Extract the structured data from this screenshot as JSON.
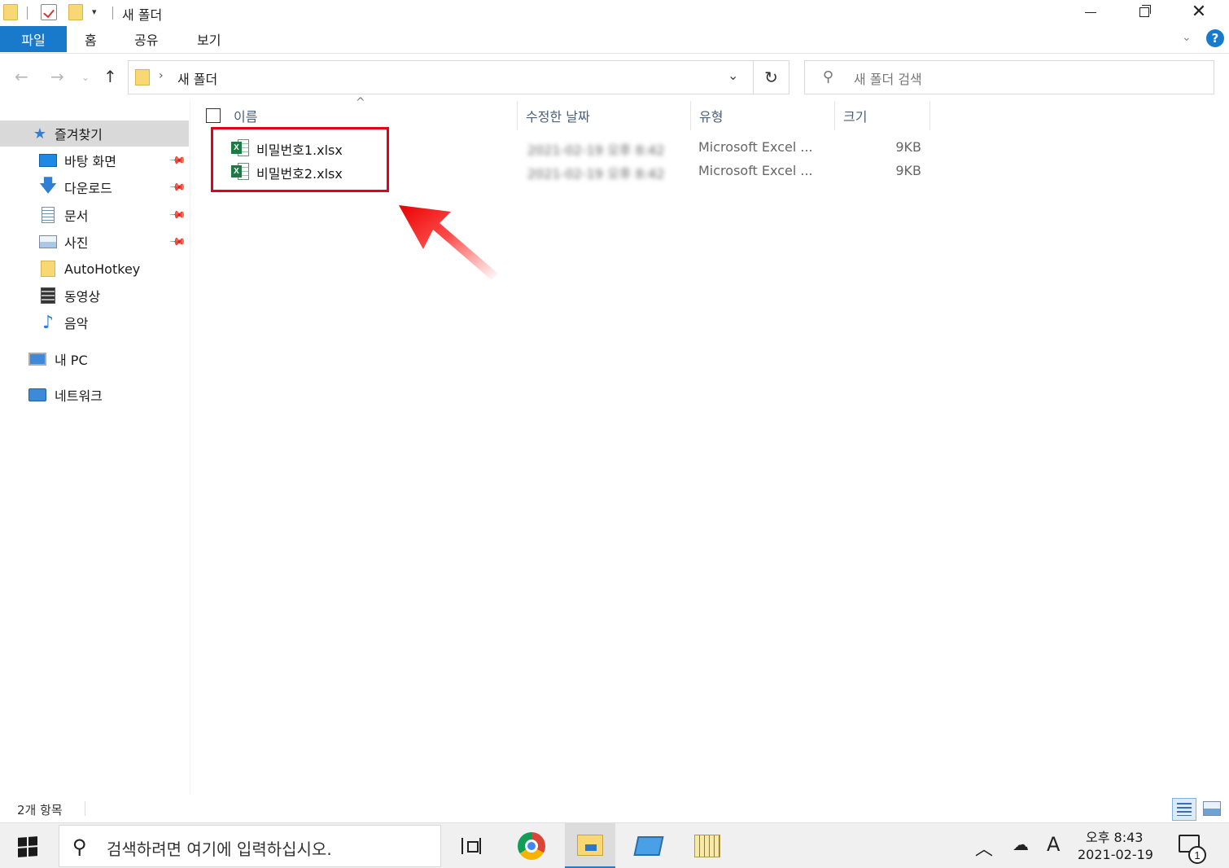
{
  "window": {
    "title": "새 폴더",
    "quick_access_dropdown": "▾"
  },
  "ribbon": {
    "tabs": [
      "파일",
      "홈",
      "공유",
      "보기"
    ],
    "help_label": "?"
  },
  "address": {
    "path": "새 폴더",
    "separator": "›"
  },
  "search": {
    "placeholder": "새 폴더 검색"
  },
  "nav_pane": {
    "items": [
      {
        "label": "즐겨찾기",
        "icon": "star-icon",
        "pinned": false,
        "selected": true
      },
      {
        "label": "바탕 화면",
        "icon": "desktop-icon",
        "pinned": true
      },
      {
        "label": "다운로드",
        "icon": "download-icon",
        "pinned": true
      },
      {
        "label": "문서",
        "icon": "document-icon",
        "pinned": true
      },
      {
        "label": "사진",
        "icon": "pictures-icon",
        "pinned": true
      },
      {
        "label": "AutoHotkey",
        "icon": "folder-icon",
        "pinned": false
      },
      {
        "label": "동영상",
        "icon": "video-icon",
        "pinned": false
      },
      {
        "label": "음악",
        "icon": "music-icon",
        "pinned": false
      },
      {
        "label": "내 PC",
        "icon": "pc-icon",
        "pinned": false
      },
      {
        "label": "네트워크",
        "icon": "network-icon",
        "pinned": false
      }
    ]
  },
  "columns": {
    "name": "이름",
    "modified": "수정한 날짜",
    "type": "유형",
    "size": "크기"
  },
  "files": [
    {
      "name": "비밀번호1.xlsx",
      "modified": "2021-02-19 오후 8:42",
      "type": "Microsoft Excel ...",
      "size": "9KB"
    },
    {
      "name": "비밀번호2.xlsx",
      "modified": "2021-02-19 오후 8:42",
      "type": "Microsoft Excel ...",
      "size": "9KB"
    }
  ],
  "status": {
    "item_count": "2개 항목"
  },
  "taskbar": {
    "search_placeholder": "검색하려면 여기에 입력하십시오.",
    "ime_indicator": "A",
    "clock_time": "오후 8:43",
    "clock_date": "2021-02-19",
    "notification_count": "1"
  },
  "colors": {
    "accent": "#1979ca",
    "highlight_box": "#e3001b",
    "excel_green": "#1d7a45"
  }
}
